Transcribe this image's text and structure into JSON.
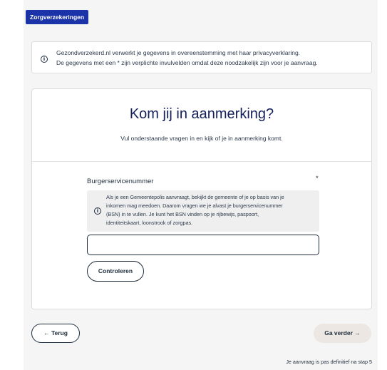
{
  "header": {
    "tag_label": "Zorgverzekeringen"
  },
  "privacy_notice": {
    "icon": "info-icon",
    "line1": "Gezondverzekerd.nl verwerkt je gegevens in overeenstemming met haar privacyverklaring.",
    "line2": "De gegevens met een * zijn verplichte invulvelden omdat deze noodzakelijk zijn voor je aanvraag."
  },
  "card": {
    "title": "Kom jij in aanmerking?",
    "subtitle": "Vul onderstaande vragen in en kijk of je in aanmerking komt."
  },
  "bsn_field": {
    "label": "Burgerservicenummer",
    "required_marker": "*",
    "hint_lines": [
      "Als je een Gemeentepolis aanvraagt, bekijkt de gemeente of je op basis van je",
      "inkomen mag meedoen. Daarom vragen we je alvast je burgerservicenummer",
      "(BSN) in te vullen. Je kunt het BSN vinden op je rijbewijs, paspoort,",
      "identiteitskaart, loonstrook of zorgpas."
    ],
    "value": "",
    "check_label": "Controleren"
  },
  "navigation": {
    "back_label": "← Terug",
    "next_label": "Ga verder →",
    "footnote": "Je aanvraag is pas definitief na stap 5"
  },
  "colors": {
    "brand_blue": "#1a33a8",
    "title_navy": "#14205a",
    "next_button_bg": "#ece7e2",
    "page_bg": "#f5f5f5"
  }
}
